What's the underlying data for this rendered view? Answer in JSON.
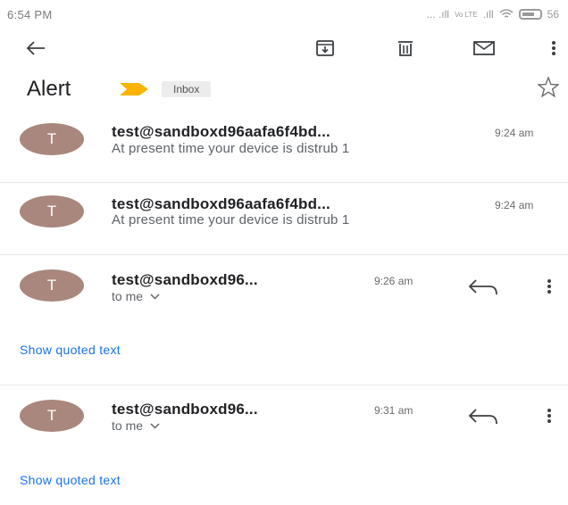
{
  "status_bar": {
    "time": "6:54 PM",
    "network": "... .ıll",
    "network_badge": "Vo LTE",
    "battery": "56"
  },
  "toolbar": {
    "back_icon": "arrow-left-icon",
    "archive_icon": "archive-icon",
    "delete_icon": "trash-icon",
    "mark_unread_icon": "mail-icon",
    "more_icon": "more-vert-icon"
  },
  "thread": {
    "subject": "Alert",
    "label": "Inbox",
    "importance_color": "#f9b300"
  },
  "messages": [
    {
      "avatar": "T",
      "sender": "test@sandboxd96aafa6f4bd...",
      "time": "9:24 am",
      "snippet": "At present time your device is distrub 1"
    },
    {
      "avatar": "T",
      "sender": "test@sandboxd96aafa6f4bd...",
      "time": "9:24 am",
      "snippet": "At present time your device is distrub 1"
    },
    {
      "avatar": "T",
      "sender": "test@sandboxd96...",
      "time": "9:26 am",
      "recipient": "to me",
      "quoted_link": "Show quoted text"
    },
    {
      "avatar": "T",
      "sender": "test@sandboxd96...",
      "time": "9:31 am",
      "recipient": "to me",
      "quoted_link": "Show quoted text"
    }
  ],
  "colors": {
    "avatar": "#a9877c",
    "link": "#1a73e8"
  }
}
